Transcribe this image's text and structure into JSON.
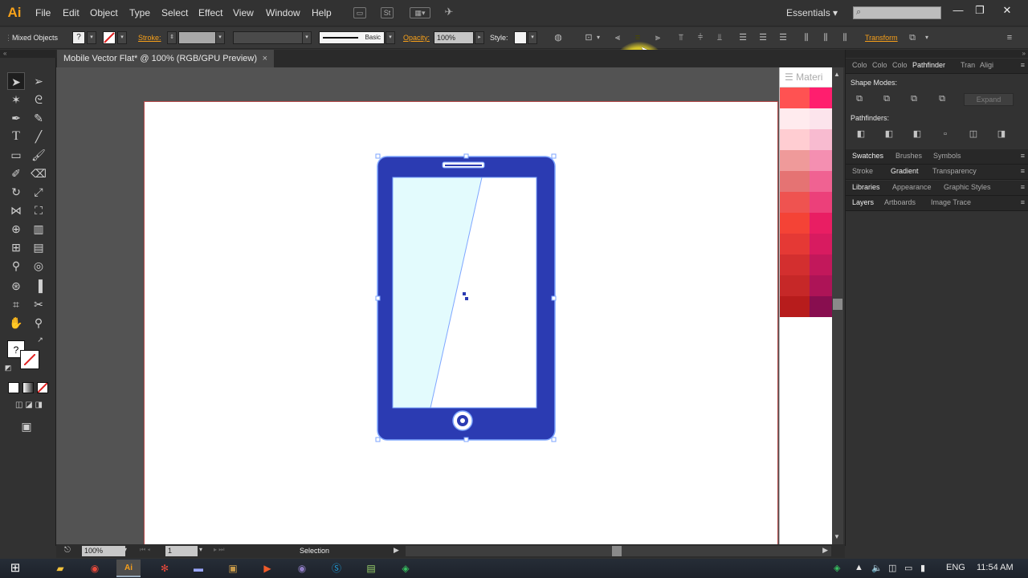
{
  "app": {
    "logo": "Ai"
  },
  "menu": {
    "items": [
      "File",
      "Edit",
      "Object",
      "Type",
      "Select",
      "Effect",
      "View",
      "Window",
      "Help"
    ],
    "workspace": "Essentials",
    "workspace_caret": "▾",
    "search_icon": "⌕"
  },
  "window_controls": {
    "minimize": "—",
    "restore": "❐",
    "close": "✕"
  },
  "control_bar": {
    "selection_type": "Mixed Objects",
    "fill_icon": "?",
    "stroke_label": "Stroke:",
    "brush_label": "Basic",
    "opacity_label": "Opacity:",
    "opacity_value": "100%",
    "style_label": "Style:",
    "transform_label": "Transform"
  },
  "document": {
    "tab_title": "Mobile Vector Flat* @ 100% (RGB/GPU Preview)",
    "tab_close": "×"
  },
  "swatch_panel": {
    "title": "Materi",
    "menu_icon": "☰"
  },
  "right_panels": {
    "top_tabs": [
      "Colo",
      "Colo",
      "Colo",
      "Pathfinder",
      "Tran",
      "Aligi"
    ],
    "active_top_tab": "Pathfinder",
    "shape_modes_label": "Shape Modes:",
    "pathfinders_label": "Pathfinders:",
    "expand_label": "Expand",
    "group1": [
      "Swatches",
      "Brushes",
      "Symbols"
    ],
    "group2": [
      "Stroke",
      "Gradient",
      "Transparency"
    ],
    "group3": [
      "Libraries",
      "Appearance",
      "Graphic Styles"
    ],
    "group4": [
      "Layers",
      "Artboards",
      "Image Trace"
    ],
    "panel_menu": "≡"
  },
  "status_bar": {
    "zoom": "100%",
    "artboard_number": "1",
    "tool_status": "Selection"
  },
  "taskbar": {
    "language": "ENG",
    "time": "11:54 AM"
  },
  "colors": {
    "accent_orange": "#f7a01a",
    "phone_body": "#2b3bb2",
    "phone_screen": "#e3fbfd",
    "selection_blue": "#7ea6ff"
  },
  "swatches": [
    [
      "#ff5252",
      "#ff1e6e"
    ],
    [
      "#ffebee",
      "#fce4ec"
    ],
    [
      "#ffcdd2",
      "#f8bbd0"
    ],
    [
      "#ef9a9a",
      "#f48fb1"
    ],
    [
      "#e57373",
      "#f06292"
    ],
    [
      "#ef5350",
      "#ec407a"
    ],
    [
      "#f44336",
      "#e91e63"
    ],
    [
      "#e53935",
      "#d81b60"
    ],
    [
      "#d32f2f",
      "#c2185b"
    ],
    [
      "#c62828",
      "#ad1457"
    ],
    [
      "#b71c1c",
      "#880e4f"
    ]
  ]
}
